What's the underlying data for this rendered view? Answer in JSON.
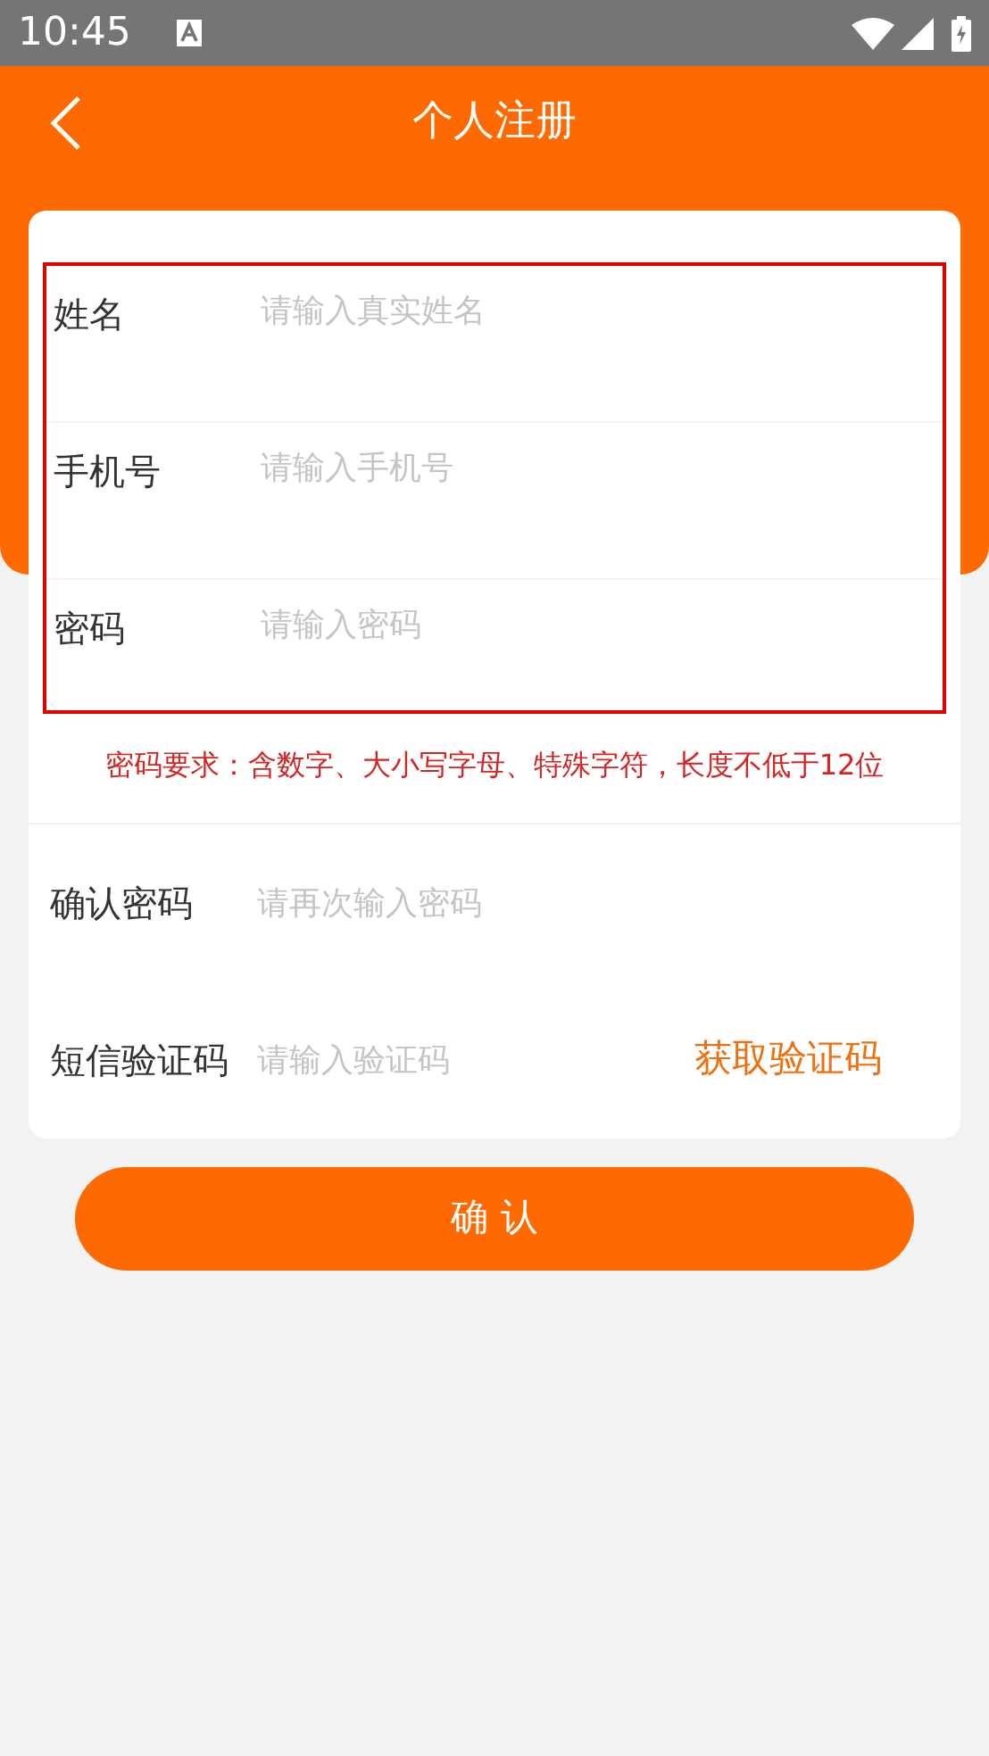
{
  "status_bar": {
    "time": "10:45"
  },
  "header": {
    "title": "个人注册"
  },
  "fields": [
    {
      "label": "姓名",
      "placeholder": "请输入真实姓名",
      "highlighted": true,
      "kind": "text"
    },
    {
      "label": "手机号",
      "placeholder": "请输入手机号",
      "highlighted": true,
      "kind": "text"
    },
    {
      "label": "密码",
      "placeholder": "请输入密码",
      "highlighted": true,
      "kind": "text"
    },
    {
      "kind": "hint",
      "text": "密码要求：含数字、大小写字母、特殊字符，长度不低于12位"
    },
    {
      "label": "确认密码",
      "placeholder": "请再次输入密码",
      "kind": "text"
    },
    {
      "label": "短信验证码",
      "placeholder": "请输入验证码",
      "kind": "code",
      "action": "获取验证码"
    }
  ],
  "submit": "确 认"
}
